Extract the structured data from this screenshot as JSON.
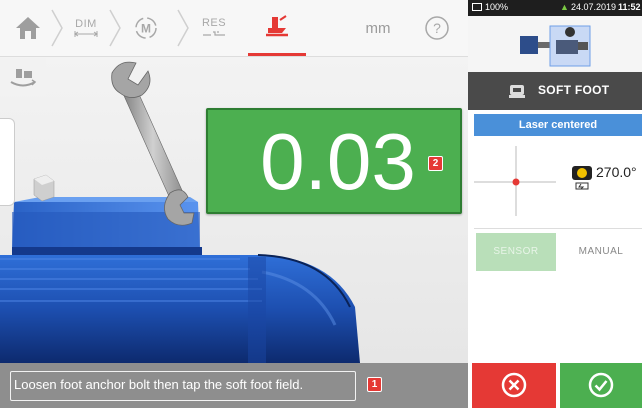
{
  "toolbar": {
    "home_icon": "home-icon",
    "dim_label": "DIM",
    "measure_icon_letter": "M",
    "res_label": "RES",
    "soft_foot_icon": "soft-foot-icon",
    "units_label": "mm",
    "help_icon": "help-icon"
  },
  "measurement": {
    "value": "0.03",
    "value_badge": "2"
  },
  "message": {
    "text": "Loosen foot anchor bolt then tap the soft foot field.",
    "badge": "1"
  },
  "status_bar": {
    "battery": "100%",
    "date": "24.07.2019",
    "time": "11:52"
  },
  "panel": {
    "title": "SOFT FOOT",
    "laser_status": "Laser centered",
    "angle": "270.0°",
    "sensor_button": "SENSOR",
    "manual_button": "MANUAL"
  },
  "colors": {
    "accent_red": "#e53935",
    "value_green": "#4caf50",
    "laser_blue": "#4a90d9"
  }
}
